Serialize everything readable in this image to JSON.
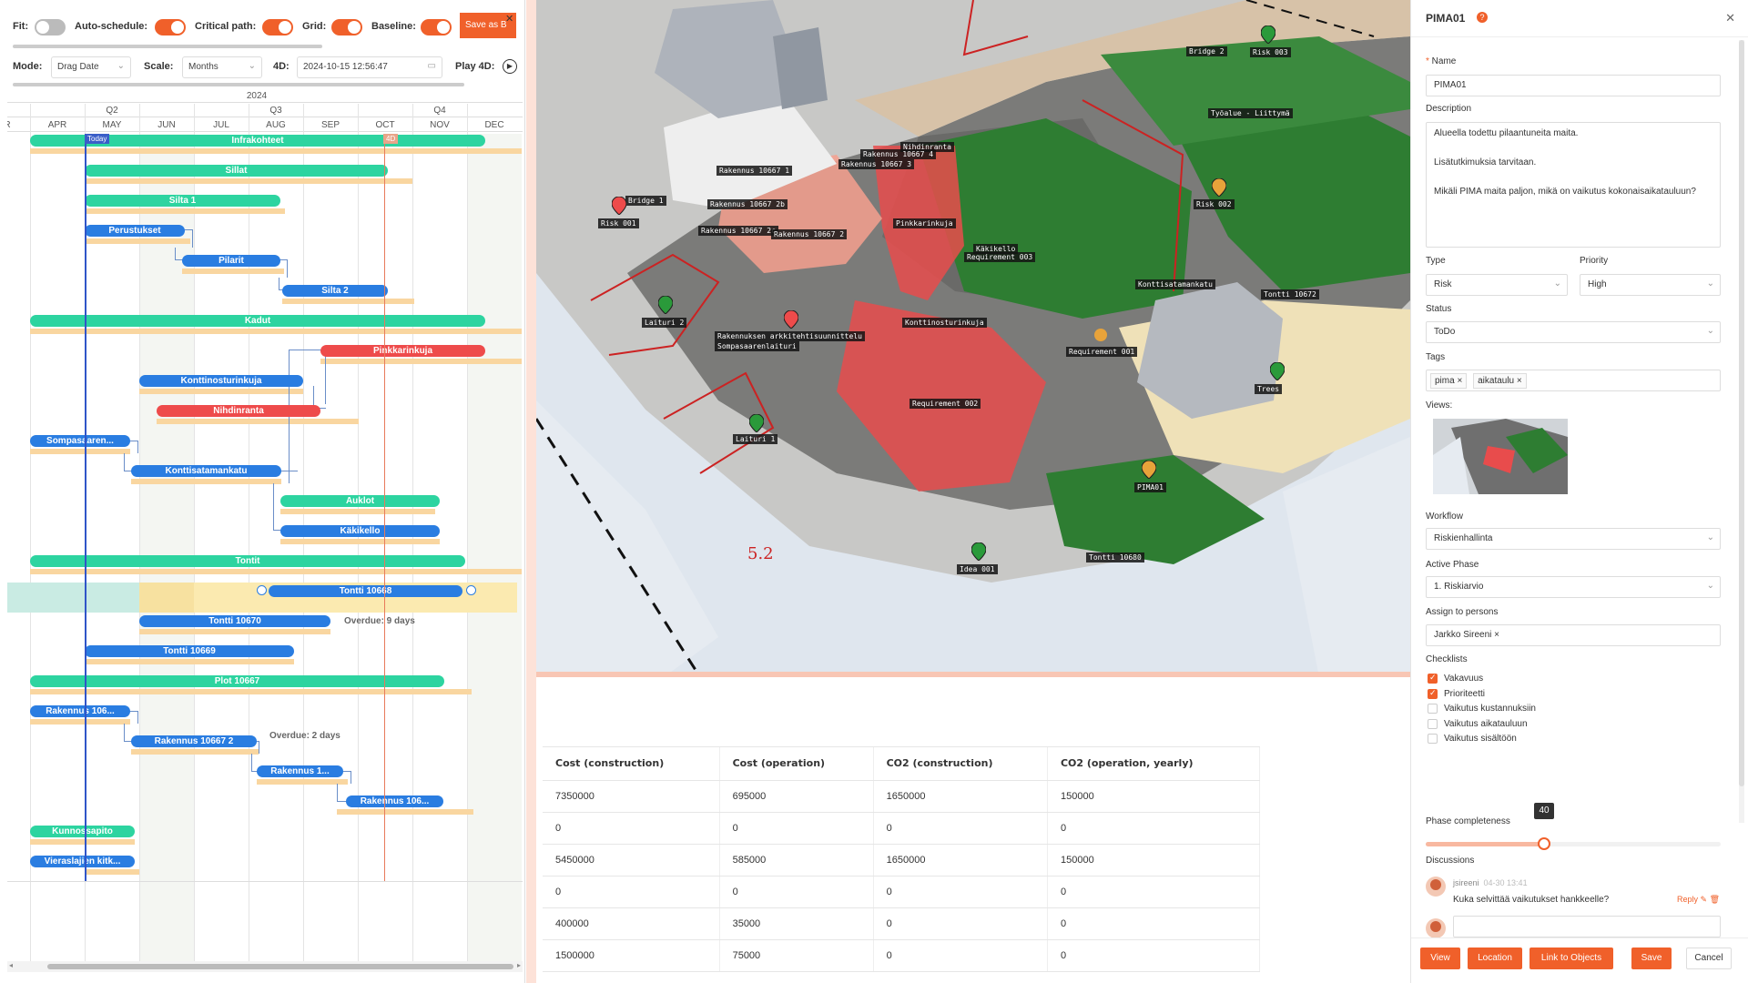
{
  "toolbar": {
    "fit_label": "Fit:",
    "auto_label": "Auto-schedule:",
    "critical_label": "Critical path:",
    "grid_label": "Grid:",
    "baseline_label": "Baseline:",
    "save_as_label": "Save as B",
    "close": "✕",
    "mode_label": "Mode:",
    "mode_value": "Drag Date",
    "scale_label": "Scale:",
    "scale_value": "Months",
    "fourd_label": "4D:",
    "fourd_value": "2024-10-15 12:56:47",
    "play_label": "Play 4D:"
  },
  "timeline": {
    "year": "2024",
    "quarters": [
      "Q2",
      "Q3",
      "Q4"
    ],
    "months": [
      "R",
      "APR",
      "MAY",
      "JUN",
      "JUL",
      "AUG",
      "SEP",
      "OCT",
      "NOV",
      "DEC"
    ],
    "today": "Today",
    "fourd_tag": "4D"
  },
  "tasks": [
    {
      "name": "Infrakohteet",
      "color": "g"
    },
    {
      "name": "Sillat",
      "color": "g"
    },
    {
      "name": "Silta 1",
      "color": "g"
    },
    {
      "name": "Perustukset",
      "color": "b"
    },
    {
      "name": "Pilarit",
      "color": "b"
    },
    {
      "name": "Silta 2",
      "color": "b"
    },
    {
      "name": "Kadut",
      "color": "g"
    },
    {
      "name": "Pinkkarinkuja",
      "color": "r"
    },
    {
      "name": "Konttinosturinkuja",
      "color": "b"
    },
    {
      "name": "Nihdinranta",
      "color": "r"
    },
    {
      "name": "Sompasaaren...",
      "color": "b"
    },
    {
      "name": "Konttisatamankatu",
      "color": "b"
    },
    {
      "name": "Auklot",
      "color": "g"
    },
    {
      "name": "Käkikello",
      "color": "b"
    },
    {
      "name": "Tontit",
      "color": "g"
    },
    {
      "name": "Tontti 10668",
      "color": "b"
    },
    {
      "name": "Tontti 10670",
      "color": "b"
    },
    {
      "name": "Tontti 10669",
      "color": "b"
    },
    {
      "name": "Plot 10667",
      "color": "g"
    },
    {
      "name": "Rakennus 106...",
      "color": "b"
    },
    {
      "name": "Rakennus 10667 2",
      "color": "b"
    },
    {
      "name": "Rakennus 1...",
      "color": "b"
    },
    {
      "name": "Rakennus 106...",
      "color": "b"
    },
    {
      "name": "Kunnossapito",
      "color": "g"
    },
    {
      "name": "Vieraslajien kitk...",
      "color": "b"
    }
  ],
  "notes": {
    "overdue1": "Overdue: 9 days",
    "overdue2": "Overdue: 2 days"
  },
  "map_labels": {
    "bridge2": "Bridge 2",
    "risk003": "Risk 003",
    "tyoalue": "Työalue - Liittymä",
    "nihdinranta": "Nihdinranta",
    "rak4": "Rakennus 10667 4",
    "rak3": "Rakennus 10667 3",
    "rak1": "Rakennus 10667 1",
    "bridge1": "Bridge 1",
    "rak2b": "Rakennus 10667 2b",
    "risk001": "Risk 001",
    "rak2c": "Rakennus 10667 2c",
    "rak2": "Rakennus 10667 2",
    "pinkkarinkuja": "Pinkkarinkuja",
    "kakikello": "Käkikello",
    "req003": "Requirement 003",
    "risk002": "Risk 002",
    "konttisatamankatu": "Konttisatamankatu",
    "tontti10672": "Tontti 10672",
    "laituri2": "Laituri 2",
    "konttinosturinkuja": "Konttinosturinkuja",
    "arkkitehti": "Rakennuksen arkkitehtisuunnittelu",
    "sompasaarenlaituri": "Sompasaarenlaituri",
    "req001": "Requirement 001",
    "trees": "Trees",
    "req002": "Requirement 002",
    "laituri1": "Laituri 1",
    "pima01": "PIMA01",
    "tontti10680": "Tontti 10680",
    "idea001": "Idea 001",
    "num": "5.2"
  },
  "table": {
    "headers": [
      "Cost (construction)",
      "Cost (operation)",
      "CO2 (construction)",
      "CO2 (operation, yearly)"
    ],
    "rows": [
      [
        "7350000",
        "695000",
        "1650000",
        "150000"
      ],
      [
        "0",
        "0",
        "0",
        "0"
      ],
      [
        "5450000",
        "585000",
        "1650000",
        "150000"
      ],
      [
        "0",
        "0",
        "0",
        "0"
      ],
      [
        "400000",
        "35000",
        "0",
        "0"
      ],
      [
        "1500000",
        "75000",
        "0",
        "0"
      ]
    ]
  },
  "panel": {
    "title": "PIMA01",
    "name_label": "Name",
    "name_value": "PIMA01",
    "desc_label": "Description",
    "desc_p1": "Alueella todettu pilaantuneita maita.",
    "desc_p2": "Lisätutkimuksia tarvitaan.",
    "desc_p3": "Mikäli PIMA maita paljon, mikä on vaikutus kokonaisaikatauluun?",
    "type_label": "Type",
    "type_value": "Risk",
    "priority_label": "Priority",
    "priority_value": "High",
    "status_label": "Status",
    "status_value": "ToDo",
    "tags_label": "Tags",
    "tags": [
      "pima",
      "aikataulu"
    ],
    "views_label": "Views:",
    "workflow_label": "Workflow",
    "workflow_value": "Riskienhallinta",
    "phase_label": "Active Phase",
    "phase_value": "1. Riskiarvio",
    "assign_label": "Assign to persons",
    "assign_value": "Jarkko Sireeni",
    "checklists_label": "Checklists",
    "checklists": [
      {
        "label": "Vakavuus",
        "checked": true
      },
      {
        "label": "Prioriteetti",
        "checked": true
      },
      {
        "label": "Vaikutus kustannuksiin",
        "checked": false
      },
      {
        "label": "Vaikutus aikatauluun",
        "checked": false
      },
      {
        "label": "Vaikutus sisältöön",
        "checked": false
      }
    ],
    "completeness_label": "Phase completeness",
    "completeness_value": 40,
    "completeness_tooltip": "40",
    "discussions_label": "Discussions",
    "comment_user": "jsireeni",
    "comment_time": "04-30 13:41",
    "comment_text": "Kuka selvittää vaikutukset hankkeelle?",
    "reply_label": "Reply",
    "buttons": [
      "View",
      "Location",
      "Link to Objects",
      "Save"
    ],
    "cancel_label": "Cancel"
  }
}
